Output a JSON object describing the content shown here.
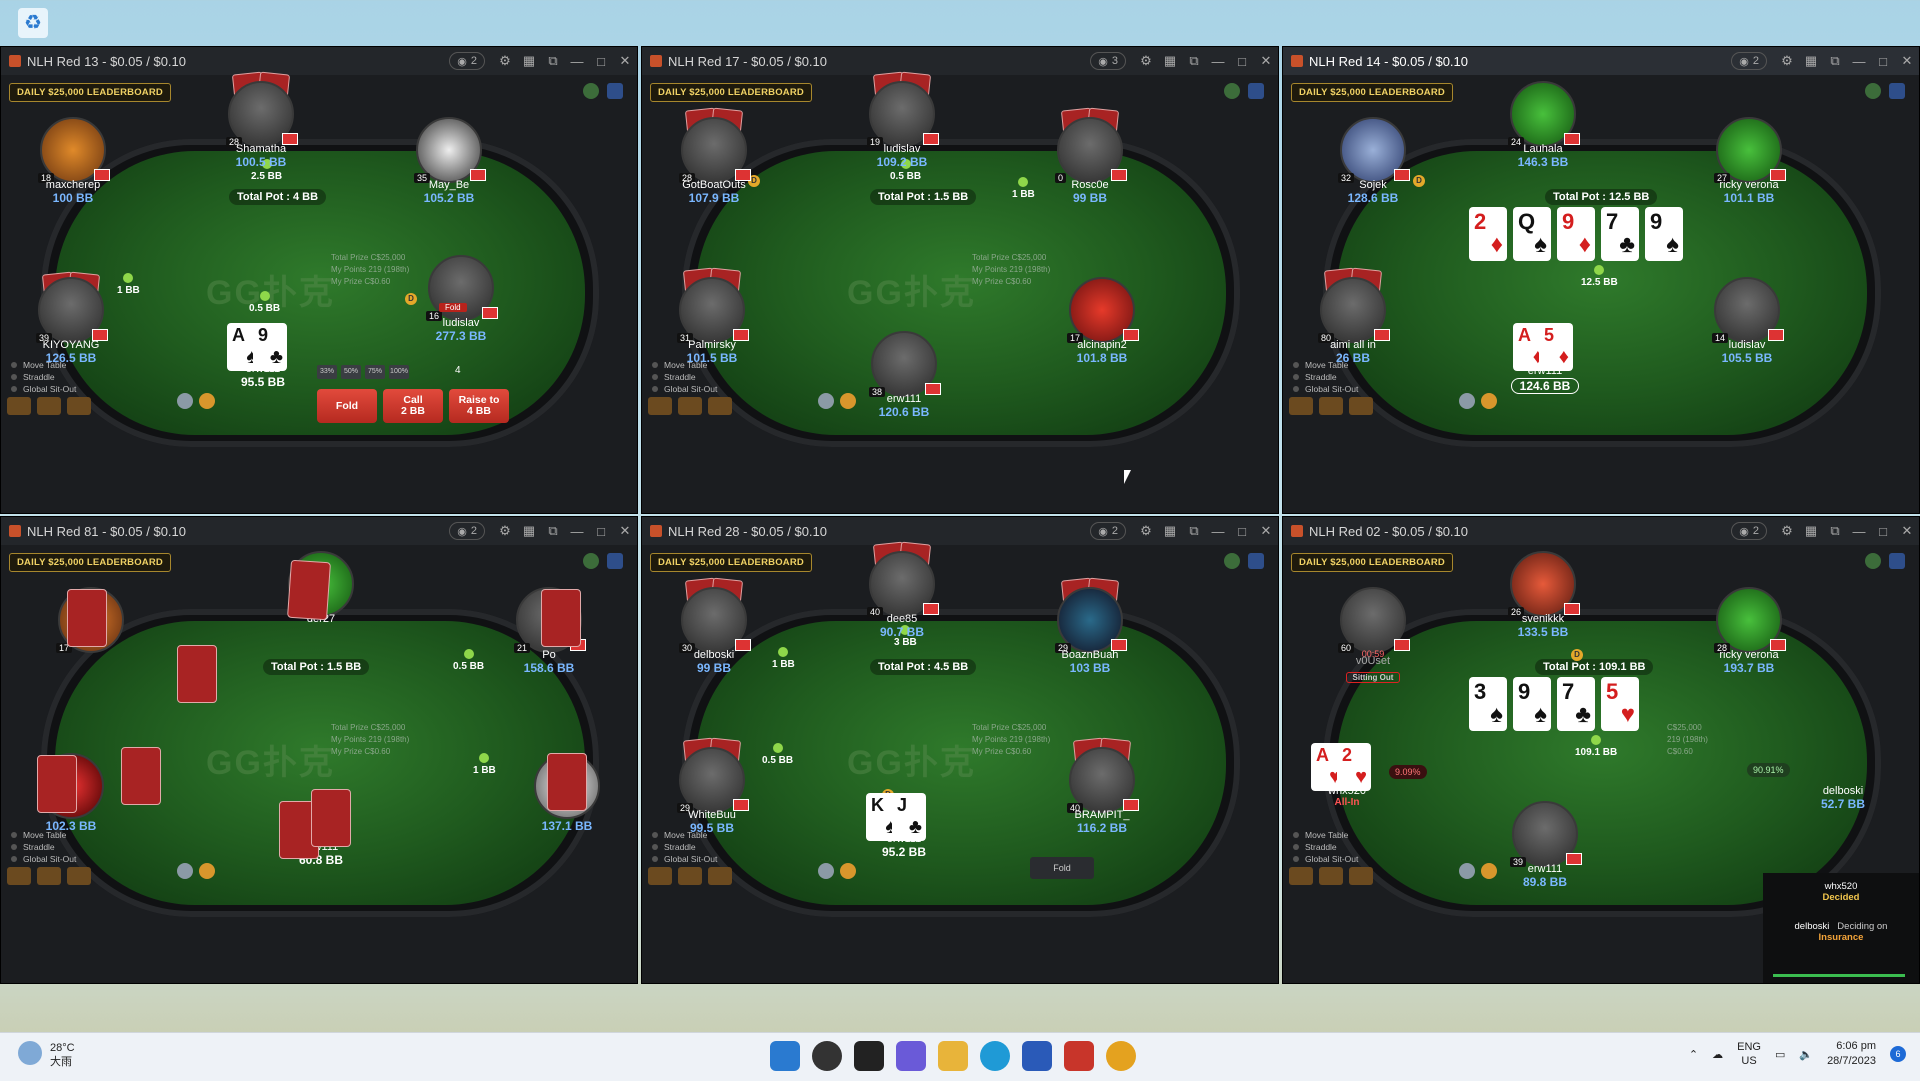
{
  "desktop": {
    "recycle_icon": "recycle-bin-icon"
  },
  "common": {
    "leaderboard": "DAILY $25,000 LEADERBOARD",
    "watermark": "GG扑克",
    "prize_labels": [
      "Total Prize",
      "My Points",
      "My Prize"
    ],
    "prize_values": [
      "C$25,000",
      "219 (198th)",
      "C$0.60"
    ],
    "tools": [
      "Move Table",
      "Straddle",
      "Global Sit-Out"
    ]
  },
  "tables": [
    {
      "title": "NLH Red 13 - $0.05 / $0.10",
      "watchers": "2",
      "pot": "Total Pot : 4 BB",
      "seats": [
        {
          "name": "Shamatha",
          "stack": "100.5 BB",
          "level": "28"
        },
        {
          "name": "maxcherep",
          "stack": "100 BB",
          "level": "18"
        },
        {
          "name": "May_Be",
          "stack": "105.2 BB",
          "level": "35"
        },
        {
          "name": "KIYOYANG",
          "stack": "126.5 BB",
          "level": "39"
        },
        {
          "name": "ludislav",
          "stack": "277.3 BB",
          "level": "16",
          "badge": "Fold"
        },
        {
          "name": "erw111",
          "stack": "95.5 BB",
          "level": "21"
        }
      ],
      "bets": [
        "2.5 BB",
        "1 BB",
        "0.5 BB"
      ],
      "hero_cards": [
        {
          "r": "A",
          "s": "♠",
          "red": false
        },
        {
          "r": "9",
          "s": "♣",
          "red": false
        }
      ],
      "presets": [
        "33%",
        "50%",
        "75%",
        "100%"
      ],
      "bet_input": "4",
      "actions": [
        "Fold",
        "Call\n2 BB",
        "Raise to\n4 BB"
      ]
    },
    {
      "title": "NLH Red 17 - $0.05 / $0.10",
      "watchers": "3",
      "pot": "Total Pot : 1.5 BB",
      "seats": [
        {
          "name": "ludislav",
          "stack": "109.2 BB",
          "level": "19"
        },
        {
          "name": "GotBoatOuts",
          "stack": "107.9 BB",
          "level": "28"
        },
        {
          "name": "Rosc0e",
          "stack": "99 BB",
          "level": "0"
        },
        {
          "name": "Palmirsky",
          "stack": "101.5 BB",
          "level": "31"
        },
        {
          "name": "alcinapin2",
          "stack": "101.8 BB",
          "level": "17"
        },
        {
          "name": "erw111",
          "stack": "120.6 BB",
          "level": "38"
        }
      ],
      "bets": [
        "0.5 BB",
        "1 BB"
      ]
    },
    {
      "title": "NLH Red 14 - $0.05 / $0.10",
      "watchers": "2",
      "pot": "Total Pot : 12.5 BB",
      "seats": [
        {
          "name": "Lauhala",
          "stack": "146.3 BB",
          "level": "24"
        },
        {
          "name": "Sojek",
          "stack": "128.6 BB",
          "level": "32"
        },
        {
          "name": "ricky verona",
          "stack": "101.1 BB",
          "level": "27"
        },
        {
          "name": "aimi all in",
          "stack": "26 BB",
          "level": "80"
        },
        {
          "name": "ludislav",
          "stack": "105.5 BB",
          "level": "14"
        },
        {
          "name": "erw111",
          "stack": "124.6 BB",
          "level": "32"
        }
      ],
      "board": [
        {
          "r": "2",
          "s": "♦",
          "red": true
        },
        {
          "r": "Q",
          "s": "♠",
          "red": false
        },
        {
          "r": "9",
          "s": "♦",
          "red": true
        },
        {
          "r": "7",
          "s": "♣",
          "red": false
        },
        {
          "r": "9",
          "s": "♠",
          "red": false
        }
      ],
      "board_bet": "12.5 BB",
      "hero_cards": [
        {
          "r": "A",
          "s": "♦",
          "red": true
        },
        {
          "r": "5",
          "s": "♦",
          "red": true
        }
      ]
    },
    {
      "title": "NLH Red 81 - $0.05 / $0.10",
      "watchers": "2",
      "pot": "Total Pot : 1.5 BB",
      "seats": [
        {
          "name": "der27",
          "stack": "",
          "level": ""
        },
        {
          "name": "",
          "stack": "",
          "level": "17"
        },
        {
          "name": "Po",
          "stack": "158.6 BB",
          "level": "21"
        },
        {
          "name": "",
          "stack": "102.3 BB",
          "level": ""
        },
        {
          "name": "",
          "stack": "137.1 BB",
          "level": ""
        },
        {
          "name": "erw111",
          "stack": "60.8 BB",
          "level": ""
        }
      ],
      "bets": [
        "0.5 BB",
        "1 BB"
      ]
    },
    {
      "title": "NLH Red 28 - $0.05 / $0.10",
      "watchers": "2",
      "pot": "Total Pot : 4.5 BB",
      "seats": [
        {
          "name": "dee85",
          "stack": "90.7 BB",
          "level": "40"
        },
        {
          "name": "delboski",
          "stack": "99 BB",
          "level": "30"
        },
        {
          "name": "BoaznBuah",
          "stack": "103 BB",
          "level": "29"
        },
        {
          "name": "WhiteBuu",
          "stack": "99.5 BB",
          "level": "29"
        },
        {
          "name": "BRAMPIT_",
          "stack": "116.2 BB",
          "level": "40"
        },
        {
          "name": "erw111",
          "stack": "95.2 BB",
          "level": "39"
        }
      ],
      "bets": [
        "3 BB",
        "1 BB",
        "0.5 BB"
      ],
      "hero_cards": [
        {
          "r": "K",
          "s": "♠",
          "red": false
        },
        {
          "r": "J",
          "s": "♣",
          "red": false
        }
      ],
      "fold_check": "Fold"
    },
    {
      "title": "NLH Red 02 - $0.05 / $0.10",
      "watchers": "2",
      "pot": "Total Pot : 109.1 BB",
      "seats": [
        {
          "name": "svenikkk",
          "stack": "133.5 BB",
          "level": "26"
        },
        {
          "name": "v0Uset",
          "stack": "Sitting Out",
          "level": "60",
          "timer": "00:59"
        },
        {
          "name": "ricky verona",
          "stack": "193.7 BB",
          "level": "28"
        },
        {
          "name": "whx520",
          "stack": "All-In",
          "level": "20"
        },
        {
          "name": "delboski",
          "stack": "52.7 BB",
          "level": "21"
        },
        {
          "name": "erw111",
          "stack": "89.8 BB",
          "level": "39"
        }
      ],
      "board": [
        {
          "r": "3",
          "s": "♠",
          "red": false
        },
        {
          "r": "9",
          "s": "♠",
          "red": false
        },
        {
          "r": "7",
          "s": "♣",
          "red": false
        },
        {
          "r": "5",
          "s": "♥",
          "red": true
        }
      ],
      "board_bet": "109.1 BB",
      "hero_cards": [
        {
          "r": "A",
          "s": "♥",
          "red": true
        },
        {
          "r": "2",
          "s": "♥",
          "red": true
        }
      ],
      "odds_left": "9.09%",
      "odds_right": "90.91%",
      "insurance": {
        "player1": "whx520",
        "status1": "Decided",
        "player2": "delboski",
        "status2": "Deciding on",
        "label": "Insurance"
      }
    }
  ],
  "taskbar": {
    "weather_temp": "28°C",
    "weather_desc": "大雨",
    "lang1": "ENG",
    "lang2": "US",
    "time": "6:06 pm",
    "date": "28/7/2023",
    "notif": "6"
  }
}
